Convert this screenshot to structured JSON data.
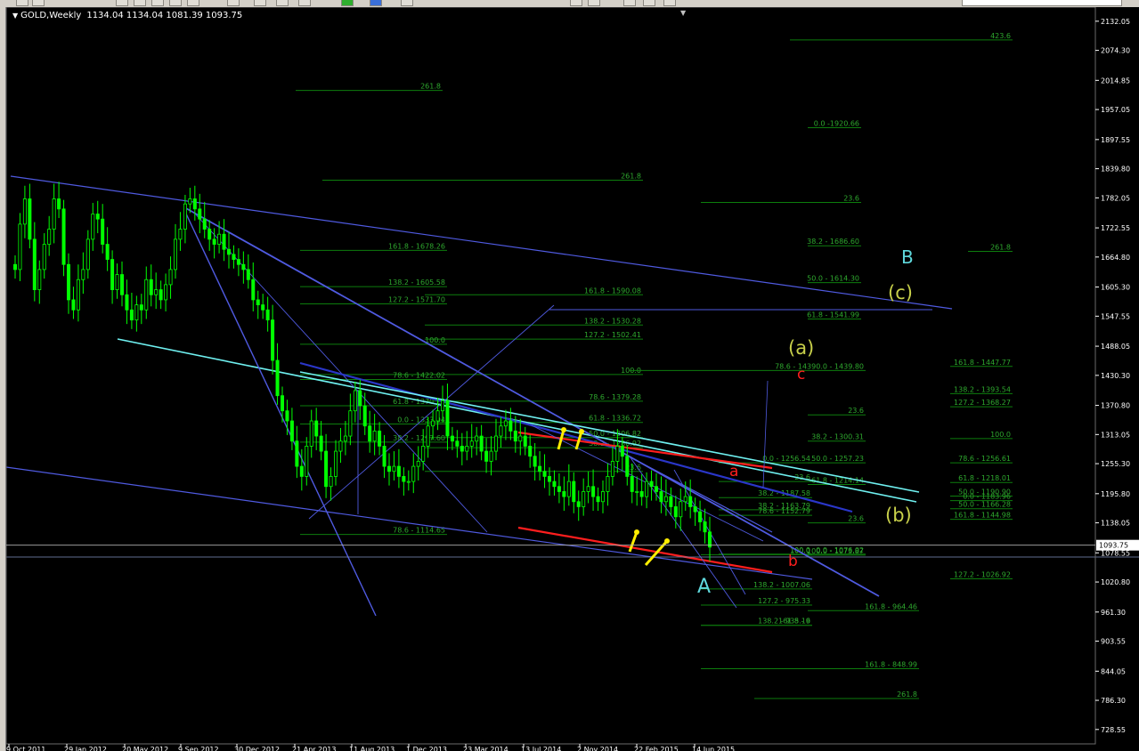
{
  "window": {
    "symbol_period": "GOLD,Weekly",
    "ohlc": "1134.04 1134.04 1081.39 1093.75",
    "icons": [
      "collapse-arrow-icon",
      "chevron-down-icon"
    ]
  },
  "colors": {
    "background": "#000000",
    "bull_candle": "#00ff00",
    "bear_candle": "#00ff00",
    "fib_line": "#0d7d0d",
    "fib_text": "#2ea82e",
    "trend_blue": "#4f5ae0",
    "trend_cyan": "#6ff0f0",
    "trend_red": "#ff1e1e",
    "wave_yellow": "#c8d04a",
    "wave_cyan": "#5fd8dc",
    "arrow_yellow": "#ffee00",
    "price_label_bg": "#ffffff"
  },
  "chart_data": {
    "type": "candlestick",
    "ylim": [
      700,
      2160
    ],
    "current_price": "1093.75",
    "y_ticks": [
      "2132.05",
      "2074.30",
      "2014.85",
      "1957.05",
      "1897.55",
      "1839.80",
      "1782.05",
      "1722.55",
      "1664.80",
      "1605.30",
      "1547.55",
      "1488.05",
      "1430.30",
      "1370.80",
      "1313.05",
      "1255.30",
      "1195.80",
      "1138.05",
      "1078.55",
      "1020.80",
      "961.30",
      "903.55",
      "844.05",
      "786.30",
      "728.55"
    ],
    "x_ticks": [
      "9 Oct 2011",
      "29 Jan 2012",
      "20 May 2012",
      "9 Sep 2012",
      "30 Dec 2012",
      "21 Apr 2013",
      "11 Aug 2013",
      "1 Dec 2013",
      "23 Mar 2014",
      "13 Jul 2014",
      "2 Nov 2014",
      "22 Feb 2015",
      "14 Jun 2015"
    ],
    "fib_labels": [
      {
        "text": "423.6",
        "price": 2095
      },
      {
        "text": "261.8",
        "price": 1995
      },
      {
        "text": "0.0 -1920.66",
        "price": 1921
      },
      {
        "text": "261.8",
        "price": 1817
      },
      {
        "text": "23.6",
        "price": 1773
      },
      {
        "text": "161.8 - 1678.26",
        "price": 1678
      },
      {
        "text": "38.2 - 1686.60",
        "price": 1687
      },
      {
        "text": "261.8",
        "price": 1676
      },
      {
        "text": "138.2 - 1605.58",
        "price": 1606
      },
      {
        "text": "50.0 - 1614.30",
        "price": 1614
      },
      {
        "text": "161.8 - 1590.08",
        "price": 1590
      },
      {
        "text": "127.2 - 1571.70",
        "price": 1572
      },
      {
        "text": "61.8 - 1541.99",
        "price": 1542
      },
      {
        "text": "138.2 - 1530.28",
        "price": 1530
      },
      {
        "text": "127.2 - 1502.41",
        "price": 1502
      },
      {
        "text": "100.0",
        "price": 1492
      },
      {
        "text": "161.8 - 1447.77",
        "price": 1448
      },
      {
        "text": "100.0",
        "price": 1432
      },
      {
        "text": "78.6 - 14390.0 - 1439.80",
        "price": 1440
      },
      {
        "text": "78.6 - 1422.02",
        "price": 1422
      },
      {
        "text": "138.2 - 1393.54",
        "price": 1394
      },
      {
        "text": "61.8 - 1370.28",
        "price": 1370
      },
      {
        "text": "78.6 - 1379.28",
        "price": 1379
      },
      {
        "text": "127.2 - 1368.27",
        "price": 1368
      },
      {
        "text": "23.6",
        "price": 1352
      },
      {
        "text": "0.0 - 1333.94",
        "price": 1334
      },
      {
        "text": "61.8 - 1336.72",
        "price": 1337
      },
      {
        "text": "50.0 - 1306.82",
        "price": 1307
      },
      {
        "text": "38.2 - 1300.31",
        "price": 1300
      },
      {
        "text": "100.0",
        "price": 1305
      },
      {
        "text": "38.2 - 1297.60",
        "price": 1298
      },
      {
        "text": "38.2 - 1286.92",
        "price": 1287
      },
      {
        "text": "0.0 - 1256.54",
        "price": 1257
      },
      {
        "text": "50.0 - 1257.23",
        "price": 1257
      },
      {
        "text": "78.6 - 1256.61",
        "price": 1257
      },
      {
        "text": "23.6",
        "price": 1240
      },
      {
        "text": "23.6",
        "price": 1220
      },
      {
        "text": "61.8 - 1214.14",
        "price": 1214
      },
      {
        "text": "61.8 - 1218.01",
        "price": 1218
      },
      {
        "text": "38.2 - 1187.58",
        "price": 1188
      },
      {
        "text": "50.0 - 1190.90",
        "price": 1191
      },
      {
        "text": "50.0 - 1166.28",
        "price": 1166
      },
      {
        "text": "38.2 - 1163.79",
        "price": 1164
      },
      {
        "text": "161.8 - 1144.98",
        "price": 1145
      },
      {
        "text": "78.6 - 1152.79",
        "price": 1153
      },
      {
        "text": "23.6",
        "price": 1138
      },
      {
        "text": "0.0 - 1183.96",
        "price": 1182
      },
      {
        "text": "78.6 - 1114.65",
        "price": 1115
      },
      {
        "text": "100.0",
        "price": 1076
      },
      {
        "text": "100.0 - 1073.87",
        "price": 1074
      },
      {
        "text": "100.0",
        "price": 1075
      },
      {
        "text": "0.0 - 1076.02",
        "price": 1076
      },
      {
        "text": "127.2 - 1026.92",
        "price": 1027
      },
      {
        "text": "138.2 - 1007.06",
        "price": 1007
      },
      {
        "text": "127.2 - 975.33",
        "price": 975
      },
      {
        "text": "161.8 - 964.46",
        "price": 964
      },
      {
        "text": "161.8 - 9",
        "price": 935
      },
      {
        "text": "138.2 - 935.16",
        "price": 935
      },
      {
        "text": "161.8 - 848.99",
        "price": 849
      },
      {
        "text": "261.8",
        "price": 790
      }
    ],
    "wave_labels": [
      {
        "text": "B",
        "color": "cyan"
      },
      {
        "text": "(c)",
        "color": "yellow"
      },
      {
        "text": "(a)",
        "color": "yellow"
      },
      {
        "text": "c",
        "color": "red"
      },
      {
        "text": "a",
        "color": "red"
      },
      {
        "text": "(b)",
        "color": "yellow"
      },
      {
        "text": "b",
        "color": "red"
      },
      {
        "text": "A",
        "color": "cyan"
      }
    ],
    "price_series": [
      1640,
      1730,
      1780,
      1700,
      1600,
      1640,
      1690,
      1720,
      1780,
      1760,
      1650,
      1580,
      1560,
      1620,
      1640,
      1700,
      1750,
      1740,
      1690,
      1660,
      1600,
      1630,
      1590,
      1560,
      1540,
      1570,
      1560,
      1620,
      1590,
      1600,
      1580,
      1610,
      1640,
      1700,
      1720,
      1770,
      1780,
      1760,
      1740,
      1720,
      1700,
      1690,
      1710,
      1680,
      1670,
      1660,
      1650,
      1640,
      1620,
      1580,
      1570,
      1560,
      1540,
      1460,
      1390,
      1360,
      1340,
      1300,
      1250,
      1230,
      1290,
      1340,
      1310,
      1280,
      1210,
      1230,
      1280,
      1300,
      1310,
      1360,
      1400,
      1370,
      1330,
      1300,
      1320,
      1290,
      1250,
      1240,
      1250,
      1230,
      1220,
      1220,
      1250,
      1260,
      1290,
      1330,
      1340,
      1360,
      1380,
      1310,
      1300,
      1290,
      1280,
      1290,
      1300,
      1310,
      1280,
      1260,
      1280,
      1310,
      1330,
      1340,
      1320,
      1300,
      1310,
      1290,
      1270,
      1250,
      1240,
      1230,
      1220,
      1210,
      1200,
      1190,
      1220,
      1180,
      1170,
      1200,
      1210,
      1190,
      1180,
      1200,
      1230,
      1260,
      1290,
      1270,
      1230,
      1200,
      1200,
      1190,
      1220,
      1210,
      1200,
      1180,
      1190,
      1170,
      1150,
      1180,
      1190,
      1170,
      1160,
      1140,
      1120,
      1090
    ]
  }
}
